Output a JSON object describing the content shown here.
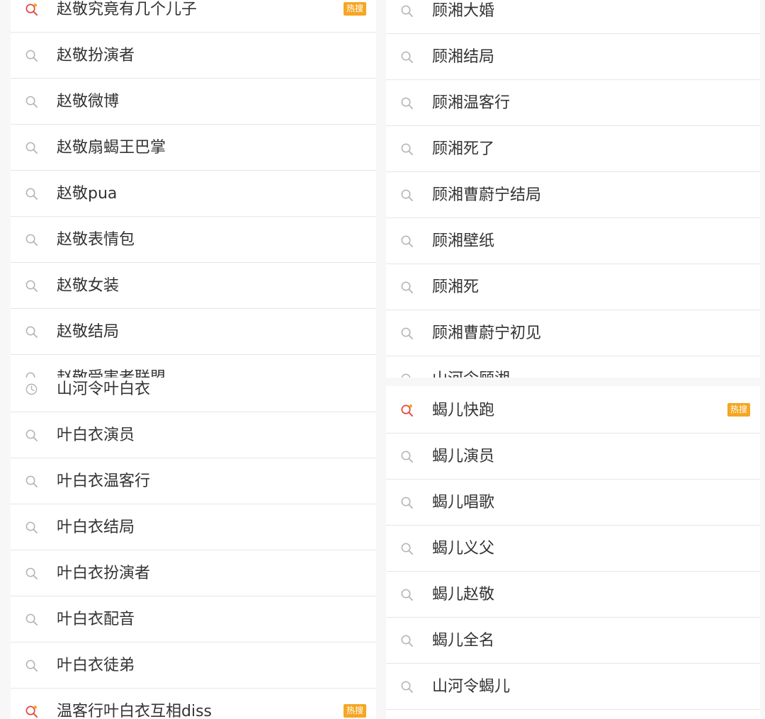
{
  "badge_color": "#f5a623",
  "icons": {
    "search": "search-icon",
    "hot": "hot-search-icon",
    "history": "history-icon"
  },
  "panels": [
    {
      "items": [
        {
          "label": "赵敬究竟有几个儿子",
          "icon": "hot",
          "badge": "热搜"
        },
        {
          "label": "赵敬扮演者",
          "icon": "search"
        },
        {
          "label": "赵敬微博",
          "icon": "search"
        },
        {
          "label": "赵敬扇蝎王巴掌",
          "icon": "search"
        },
        {
          "label": "赵敬pua",
          "icon": "search"
        },
        {
          "label": "赵敬表情包",
          "icon": "search"
        },
        {
          "label": "赵敬女装",
          "icon": "search"
        },
        {
          "label": "赵敬结局",
          "icon": "search"
        },
        {
          "label": "赵敬受害者联盟",
          "icon": "search"
        }
      ]
    },
    {
      "items": [
        {
          "label": "顾湘大婚",
          "icon": "search"
        },
        {
          "label": "顾湘结局",
          "icon": "search"
        },
        {
          "label": "顾湘温客行",
          "icon": "search"
        },
        {
          "label": "顾湘死了",
          "icon": "search"
        },
        {
          "label": "顾湘曹蔚宁结局",
          "icon": "search"
        },
        {
          "label": "顾湘壁纸",
          "icon": "search"
        },
        {
          "label": "顾湘死",
          "icon": "search"
        },
        {
          "label": "顾湘曹蔚宁初见",
          "icon": "search"
        },
        {
          "label": "山河令顾湘",
          "icon": "search"
        }
      ]
    },
    {
      "items": [
        {
          "label": "山河令叶白衣",
          "icon": "history"
        },
        {
          "label": "叶白衣演员",
          "icon": "search"
        },
        {
          "label": "叶白衣温客行",
          "icon": "search"
        },
        {
          "label": "叶白衣结局",
          "icon": "search"
        },
        {
          "label": "叶白衣扮演者",
          "icon": "search"
        },
        {
          "label": "叶白衣配音",
          "icon": "search"
        },
        {
          "label": "叶白衣徒弟",
          "icon": "search"
        },
        {
          "label": "温客行叶白衣互相diss",
          "icon": "hot",
          "badge": "热搜"
        }
      ]
    },
    {
      "items": [
        {
          "label": "蝎儿快跑",
          "icon": "hot",
          "badge": "热搜"
        },
        {
          "label": "蝎儿演员",
          "icon": "search"
        },
        {
          "label": "蝎儿唱歌",
          "icon": "search"
        },
        {
          "label": "蝎儿义父",
          "icon": "search"
        },
        {
          "label": "蝎儿赵敬",
          "icon": "search"
        },
        {
          "label": "蝎儿全名",
          "icon": "search"
        },
        {
          "label": "山河令蝎儿",
          "icon": "search"
        }
      ]
    }
  ]
}
